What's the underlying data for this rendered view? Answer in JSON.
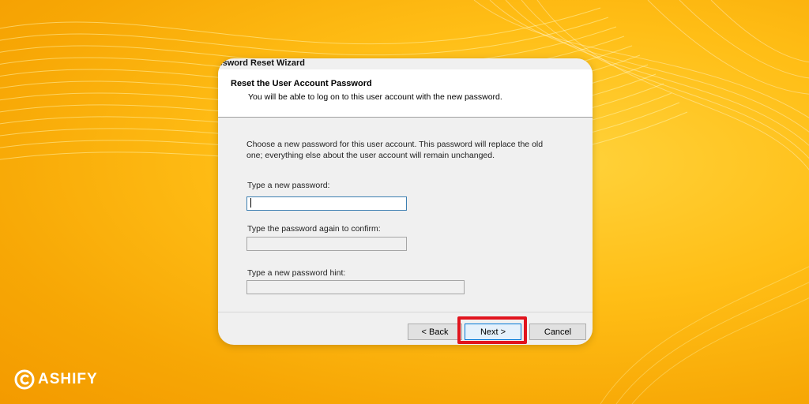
{
  "window": {
    "title": "Password Reset Wizard"
  },
  "header": {
    "title": "Reset the User Account Password",
    "subtitle": "You will be able to log on to this user account with the new password."
  },
  "body": {
    "description": "Choose a new password for this user account. This password will replace the old one; everything else about the user account will remain unchanged.",
    "new_password": {
      "label": "Type a new password:",
      "value": ""
    },
    "confirm_password": {
      "label": "Type the password again to confirm:",
      "value": ""
    },
    "hint": {
      "label": "Type a new password hint:",
      "value": ""
    }
  },
  "buttons": {
    "back": "< Back",
    "next": "Next >",
    "cancel": "Cancel"
  },
  "highlight_color": "#e1141e",
  "brand": {
    "text": "ASHIFY",
    "icon": "cashify-logo-icon"
  }
}
